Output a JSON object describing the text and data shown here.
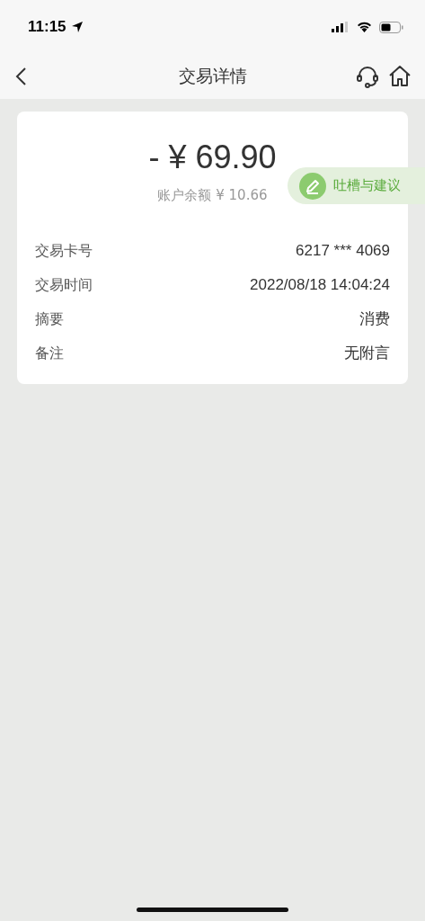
{
  "status_bar": {
    "time": "11:15"
  },
  "nav": {
    "title": "交易详情"
  },
  "summary": {
    "amount": "- ¥ 69.90",
    "balance": "账户余额 ¥ 10.66"
  },
  "feedback": {
    "label": "吐槽与建议"
  },
  "details": [
    {
      "label": "交易卡号",
      "value": "6217 *** 4069"
    },
    {
      "label": "交易时间",
      "value": "2022/08/18 14:04:24"
    },
    {
      "label": "摘要",
      "value": "消费"
    },
    {
      "label": "备注",
      "value": "无附言"
    }
  ]
}
